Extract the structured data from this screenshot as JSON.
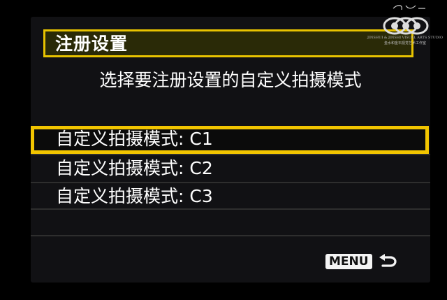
{
  "header": {
    "title": "注册设置"
  },
  "subtitle": "选择要注册设置的自定义拍摄模式",
  "list": {
    "items": [
      {
        "label": "自定义拍摄模式: C1",
        "selected": true
      },
      {
        "label": "自定义拍摄模式: C2",
        "selected": false
      },
      {
        "label": "自定义拍摄模式: C3",
        "selected": false
      }
    ]
  },
  "footer": {
    "menu_label": "MENU",
    "return_icon": "return-arrow-icon"
  },
  "watermark": {
    "line1": "JINSHUI & JINSHI VISUAL ARTS STUDIO",
    "line2": "金水和金石视觉艺术工作室"
  },
  "colors": {
    "accent": "#f2c500",
    "background": "#111114",
    "text": "#ffffff"
  }
}
